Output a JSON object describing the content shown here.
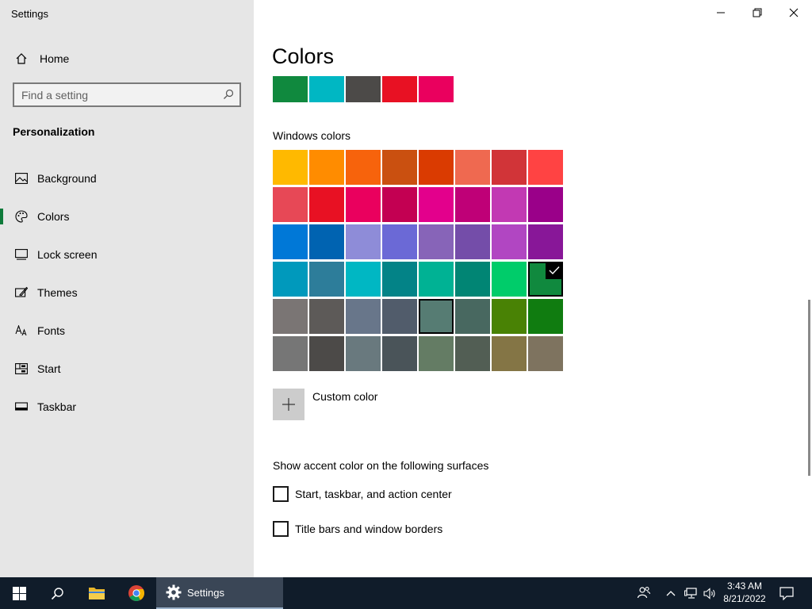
{
  "window": {
    "title": "Settings"
  },
  "sidebar": {
    "home_label": "Home",
    "search_placeholder": "Find a setting",
    "section_title": "Personalization",
    "items": [
      {
        "label": "Background",
        "icon": "image-icon"
      },
      {
        "label": "Colors",
        "icon": "palette-icon",
        "active": true
      },
      {
        "label": "Lock screen",
        "icon": "lock-screen-icon"
      },
      {
        "label": "Themes",
        "icon": "themes-icon"
      },
      {
        "label": "Fonts",
        "icon": "fonts-icon"
      },
      {
        "label": "Start",
        "icon": "start-icon"
      },
      {
        "label": "Taskbar",
        "icon": "taskbar-icon"
      }
    ]
  },
  "main": {
    "title": "Colors",
    "recent_colors": [
      "#10893e",
      "#00b7c3",
      "#4c4a48",
      "#e81123",
      "#ea005e"
    ],
    "windows_colors_label": "Windows colors",
    "windows_colors": [
      [
        "#ffb900",
        "#ff8c00",
        "#f7630c",
        "#ca5010",
        "#da3b01",
        "#ef6950",
        "#d13438",
        "#ff4343"
      ],
      [
        "#e74856",
        "#e81123",
        "#ea005e",
        "#c30052",
        "#e3008c",
        "#bf0077",
        "#c239b3",
        "#9a0089"
      ],
      [
        "#0078d7",
        "#0063b1",
        "#8e8cd8",
        "#6b69d6",
        "#8764b8",
        "#744da9",
        "#b146c2",
        "#881798"
      ],
      [
        "#0099bc",
        "#2d7d9a",
        "#00b7c3",
        "#038387",
        "#00b294",
        "#018574",
        "#00cc6a",
        "#10893e"
      ],
      [
        "#7a7574",
        "#5d5a58",
        "#68768a",
        "#515c6b",
        "#567c73",
        "#486860",
        "#498205",
        "#107c10"
      ],
      [
        "#767676",
        "#4c4a48",
        "#69797e",
        "#4a5459",
        "#647c64",
        "#525e54",
        "#847545",
        "#7e735f"
      ]
    ],
    "selected_color": "#10893e",
    "custom_color_label": "Custom color",
    "accent_heading": "Show accent color on the following surfaces",
    "checkbox_start_label": "Start, taskbar, and action center",
    "checkbox_titlebars_label": "Title bars and window borders",
    "checkbox_start_checked": false,
    "checkbox_titlebars_checked": false
  },
  "taskbar": {
    "settings_label": "Settings",
    "time": "3:43 AM",
    "date": "8/21/2022"
  }
}
